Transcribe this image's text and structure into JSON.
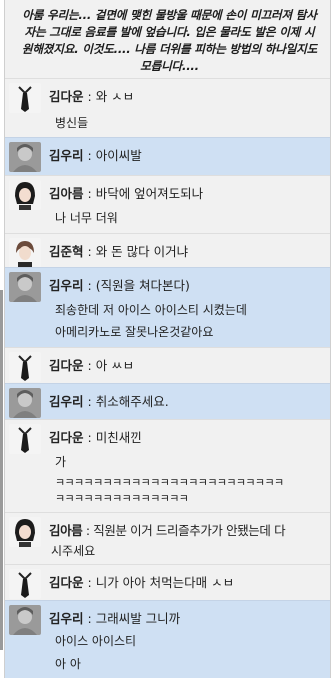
{
  "narration": "아룸 우리는... 겉면에 맺힌 물방울 때문에 손이 미끄러져 탐사자는 그대로 음료를 발에 엎습니다. 입은 물라도 발은 이제 시원해졌지요. 이것도.... 나름 더위를 피하는 방법의 하나일지도 모릅니다....",
  "separator": " : ",
  "messages": [
    {
      "name": "김다운",
      "avatar": "tie-icon",
      "text": "와 ㅅㅂ",
      "extra": [
        "병신들"
      ]
    },
    {
      "name": "김우리",
      "avatar": "gray-portrait-icon",
      "text": "아이씨발",
      "extra": []
    },
    {
      "name": "김아름",
      "avatar": "dark-hair-portrait-icon",
      "text": "바닥에 엎어져도되나",
      "extra": [
        "나 너무 더워"
      ]
    },
    {
      "name": "김준혁",
      "avatar": "brown-hair-portrait-icon",
      "text": "와 돈 많다 이거냐",
      "extra": []
    },
    {
      "name": "김우리",
      "avatar": "gray-portrait-icon",
      "text": "(직원을 쳐다본다)",
      "extra": [
        "죄송한데 저 아이스 아이스티 시켰는데",
        "아메리카노로 잘못나온것같아요"
      ]
    },
    {
      "name": "김다운",
      "avatar": "tie-icon",
      "text": "아 ㅆㅂ",
      "extra": []
    },
    {
      "name": "김우리",
      "avatar": "gray-portrait-icon",
      "text": "취소해주세요.",
      "extra": []
    },
    {
      "name": "김다운",
      "avatar": "tie-icon",
      "text": "미친새낀",
      "extra": [
        "가",
        "ㅋㅋㅋㅋㅋㅋㅋㅋㅋㅋㅋㅋㅋㅋㅋㅋㅋㅋㅋㅋㅋㅋㅋㅋ",
        "ㅋㅋㅋㅋㅋㅋㅋㅋㅋㅋㅋㅋㅋㅋ"
      ]
    },
    {
      "name": "김아름",
      "avatar": "dark-hair-portrait-icon",
      "text": "직원분 이거 드리즐추가가 안됐는데 다",
      "extra": [
        "시주세요"
      ]
    },
    {
      "name": "김다운",
      "avatar": "tie-icon",
      "text": "니가 아아 처먹는다매 ㅅㅂ",
      "extra": []
    },
    {
      "name": "김우리",
      "avatar": "gray-portrait-icon",
      "text": "그래씨발 그니까",
      "extra": [
        "아이스 아이스티",
        "아 아"
      ]
    }
  ]
}
